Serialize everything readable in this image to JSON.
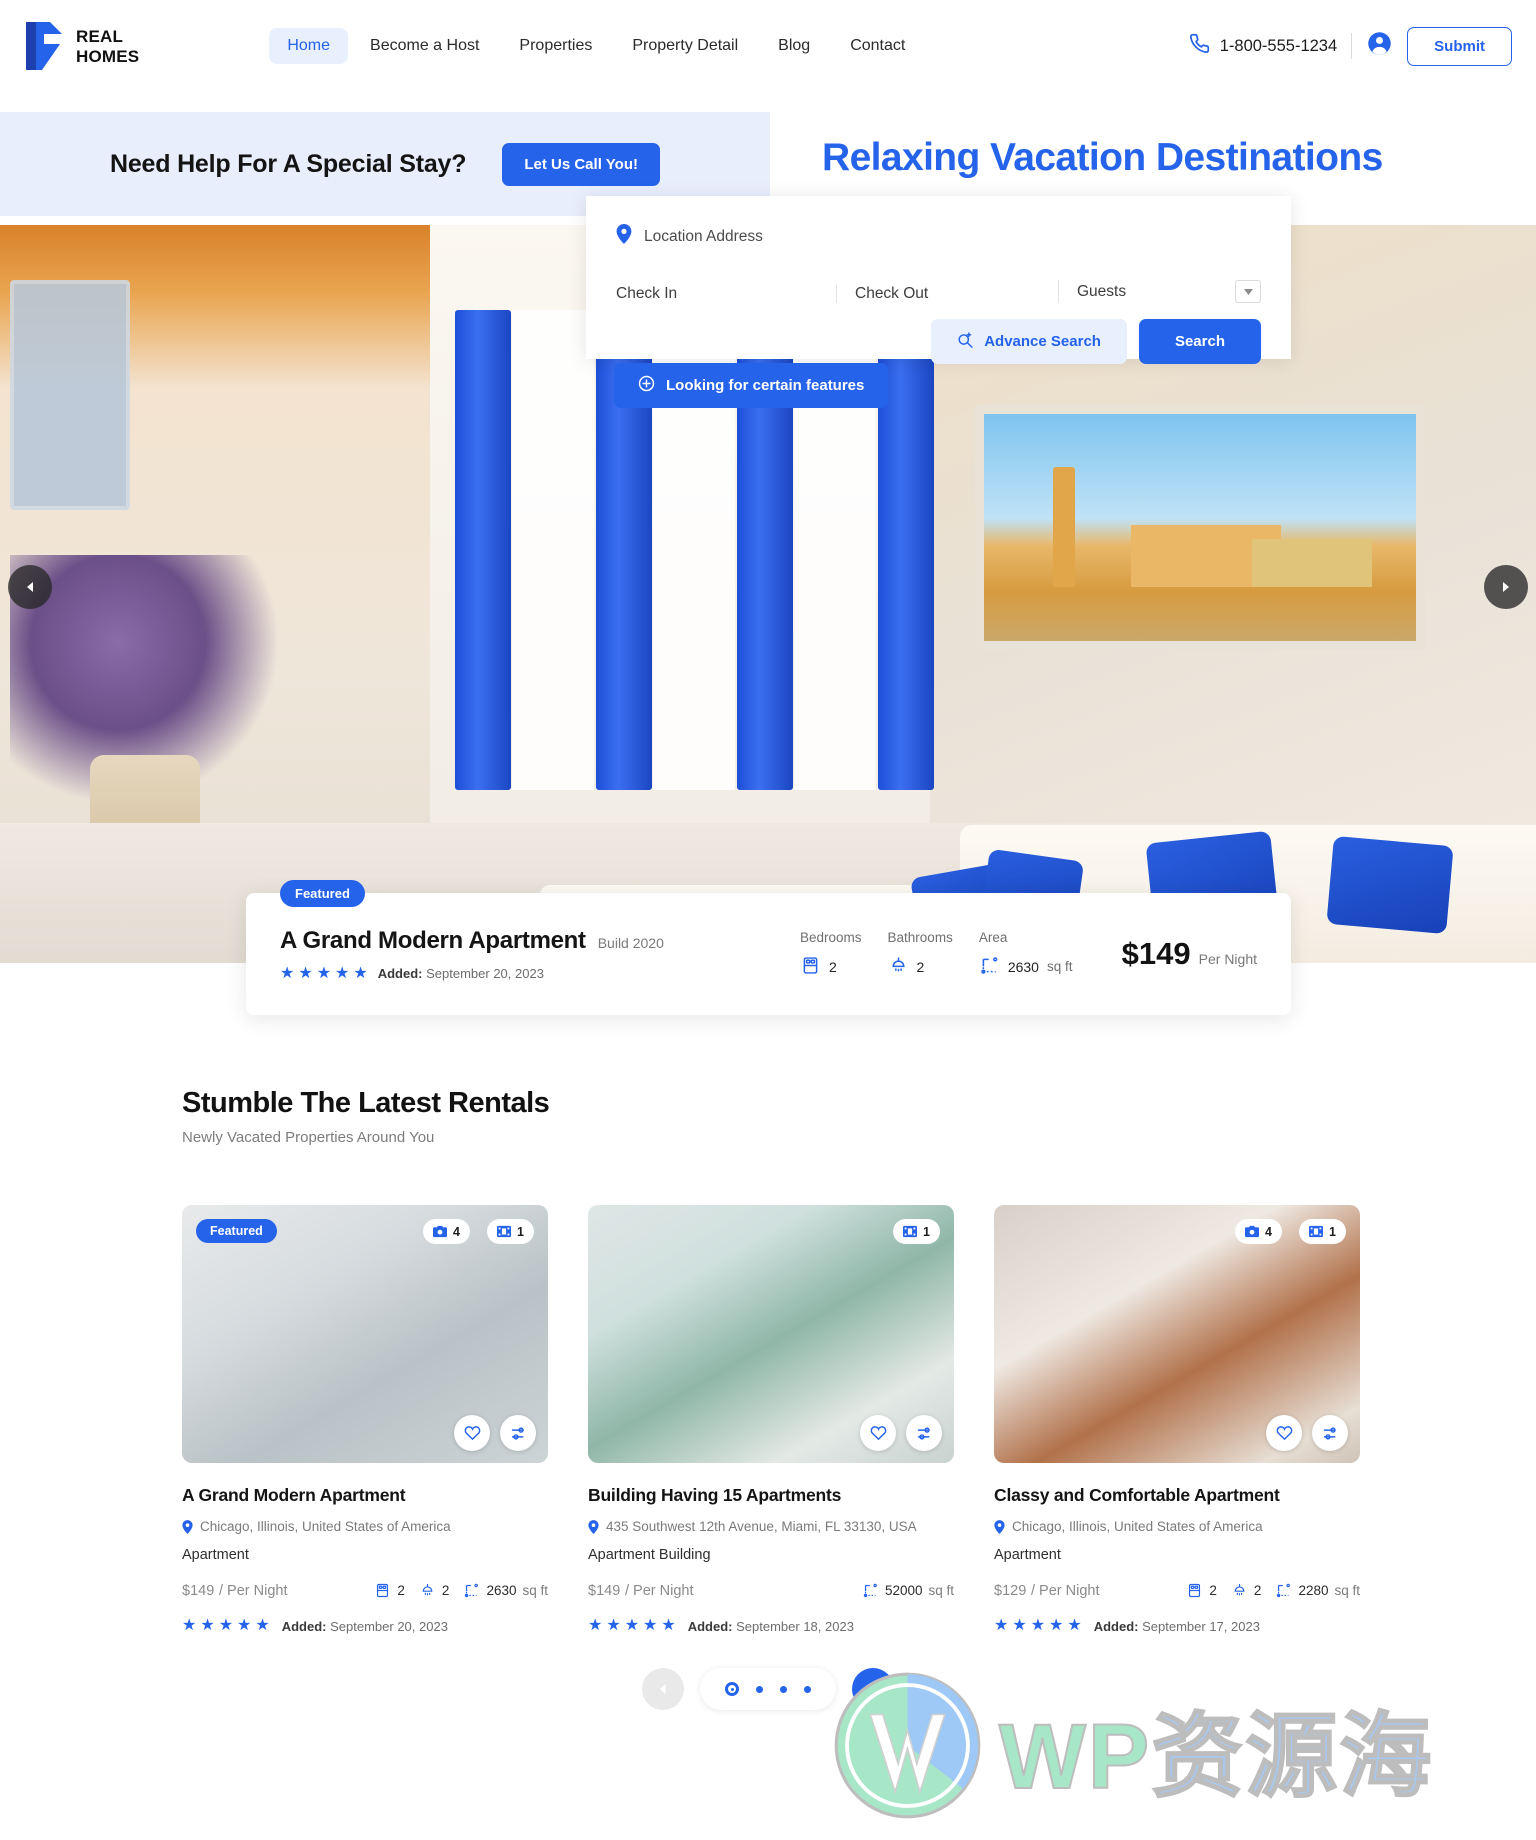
{
  "brand": {
    "line1": "REAL",
    "line2": "HOMES",
    "accent": "#2563eb",
    "logo_icon": "r-monogram-icon"
  },
  "nav": {
    "items": [
      {
        "label": "Home",
        "active": true
      },
      {
        "label": "Become a Host",
        "active": false
      },
      {
        "label": "Properties",
        "active": false
      },
      {
        "label": "Property Detail",
        "active": false
      },
      {
        "label": "Blog",
        "active": false
      },
      {
        "label": "Contact",
        "active": false
      }
    ]
  },
  "header": {
    "phone": "1-800-555-1234",
    "phone_icon": "phone-icon",
    "account_icon": "user-circle-icon",
    "submit_label": "Submit"
  },
  "help_banner": {
    "title": "Need Help For A Special Stay?",
    "cta_label": "Let Us Call You!"
  },
  "hero": {
    "title": "Relaxing Vacation Destinations",
    "prev_icon": "chevron-left-icon",
    "next_icon": "chevron-right-icon"
  },
  "search": {
    "location_icon": "map-pin-icon",
    "location_label": "Location Address",
    "checkin_label": "Check In",
    "checkout_label": "Check Out",
    "guests_label": "Guests",
    "guests_caret_icon": "chevron-down-icon",
    "advance_icon": "search-plus-icon",
    "advance_label": "Advance Search",
    "search_label": "Search",
    "features_icon": "plus-circle-icon",
    "features_label": "Looking for certain features"
  },
  "featured_card": {
    "badge": "Featured",
    "title": "A Grand Modern Apartment",
    "build": "Build 2020",
    "stars": 5,
    "added_label": "Added:",
    "added_date": "September 20, 2023",
    "specs": [
      {
        "head": "Bedrooms",
        "value": "2",
        "icon": "bed-icon",
        "unit": ""
      },
      {
        "head": "Bathrooms",
        "value": "2",
        "icon": "shower-icon",
        "unit": ""
      },
      {
        "head": "Area",
        "value": "2630",
        "icon": "area-icon",
        "unit": "sq ft"
      }
    ],
    "price": "$149",
    "price_sub": "Per Night"
  },
  "rentals": {
    "title": "Stumble The Latest Rentals",
    "subtitle": "Newly Vacated Properties Around You",
    "cards": [
      {
        "featured_pill": "Featured",
        "photo_count": "4",
        "video_count": "1",
        "photo_icon": "camera-icon",
        "video_icon": "video-icon",
        "fav_icon": "heart-icon",
        "compare_icon": "compare-icon",
        "title": "A Grand Modern Apartment",
        "location_icon": "map-pin-icon",
        "location": "Chicago, Illinois, United States of America",
        "type": "Apartment",
        "price": "$149",
        "price_sub": "/ Per Night",
        "specs": [
          {
            "icon": "bed-icon",
            "value": "2",
            "unit": ""
          },
          {
            "icon": "shower-icon",
            "value": "2",
            "unit": ""
          },
          {
            "icon": "area-icon",
            "value": "2630",
            "unit": "sq ft"
          }
        ],
        "stars": 5,
        "added_label": "Added:",
        "added_date": "September 20, 2023"
      },
      {
        "featured_pill": "",
        "photo_count": "",
        "video_count": "1",
        "photo_icon": "camera-icon",
        "video_icon": "video-icon",
        "fav_icon": "heart-icon",
        "compare_icon": "compare-icon",
        "title": "Building Having 15 Apartments",
        "location_icon": "map-pin-icon",
        "location": "435 Southwest 12th Avenue, Miami, FL 33130, USA",
        "type": "Apartment Building",
        "price": "$149",
        "price_sub": "/ Per Night",
        "specs": [
          {
            "icon": "area-icon",
            "value": "52000",
            "unit": "sq ft"
          }
        ],
        "stars": 5,
        "added_label": "Added:",
        "added_date": "September 18, 2023"
      },
      {
        "featured_pill": "",
        "photo_count": "4",
        "video_count": "1",
        "photo_icon": "camera-icon",
        "video_icon": "video-icon",
        "fav_icon": "heart-icon",
        "compare_icon": "compare-icon",
        "title": "Classy and Comfortable Apartment",
        "location_icon": "map-pin-icon",
        "location": "Chicago, Illinois, United States of America",
        "type": "Apartment",
        "price": "$129",
        "price_sub": "/ Per Night",
        "specs": [
          {
            "icon": "bed-icon",
            "value": "2",
            "unit": ""
          },
          {
            "icon": "shower-icon",
            "value": "2",
            "unit": ""
          },
          {
            "icon": "area-icon",
            "value": "2280",
            "unit": "sq ft"
          }
        ],
        "stars": 5,
        "added_label": "Added:",
        "added_date": "September 17, 2023"
      }
    ]
  },
  "carousel": {
    "prev_icon": "chevron-left-icon",
    "next_icon": "chevron-right-icon",
    "dots": 4,
    "active_dot": 0
  },
  "watermark": {
    "latin": "WP",
    "cjk": "资源海",
    "logo_icon": "wordpress-icon"
  }
}
